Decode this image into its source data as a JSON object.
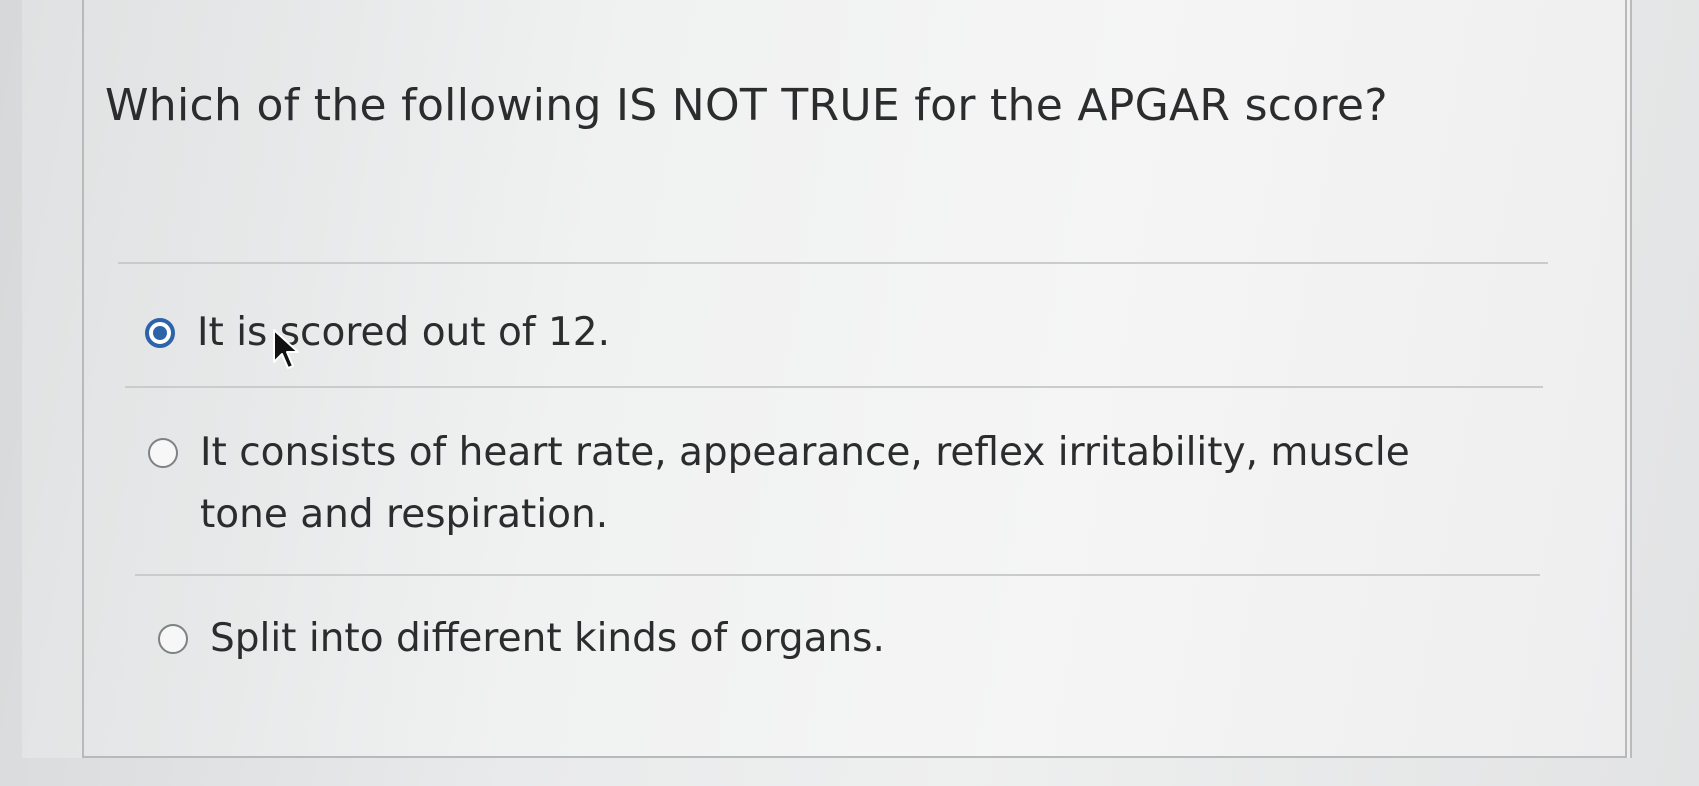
{
  "question": {
    "text": "Which of the following IS NOT TRUE for the APGAR score?"
  },
  "options": [
    {
      "label": "It is scored out of 12.",
      "selected": true
    },
    {
      "label": "It consists of heart rate, appearance, reflex irritability, muscle tone and respiration.",
      "selected": false
    },
    {
      "label": "Split into different kinds of organs.",
      "selected": false
    }
  ],
  "colors": {
    "accent": "#2d63a8",
    "text": "#2b2c2e",
    "divider": "#c9cbcd"
  },
  "icons": {
    "cursor": "mouse-pointer-icon",
    "radio_selected": "radio-selected-icon",
    "radio_unselected": "radio-unselected-icon"
  }
}
